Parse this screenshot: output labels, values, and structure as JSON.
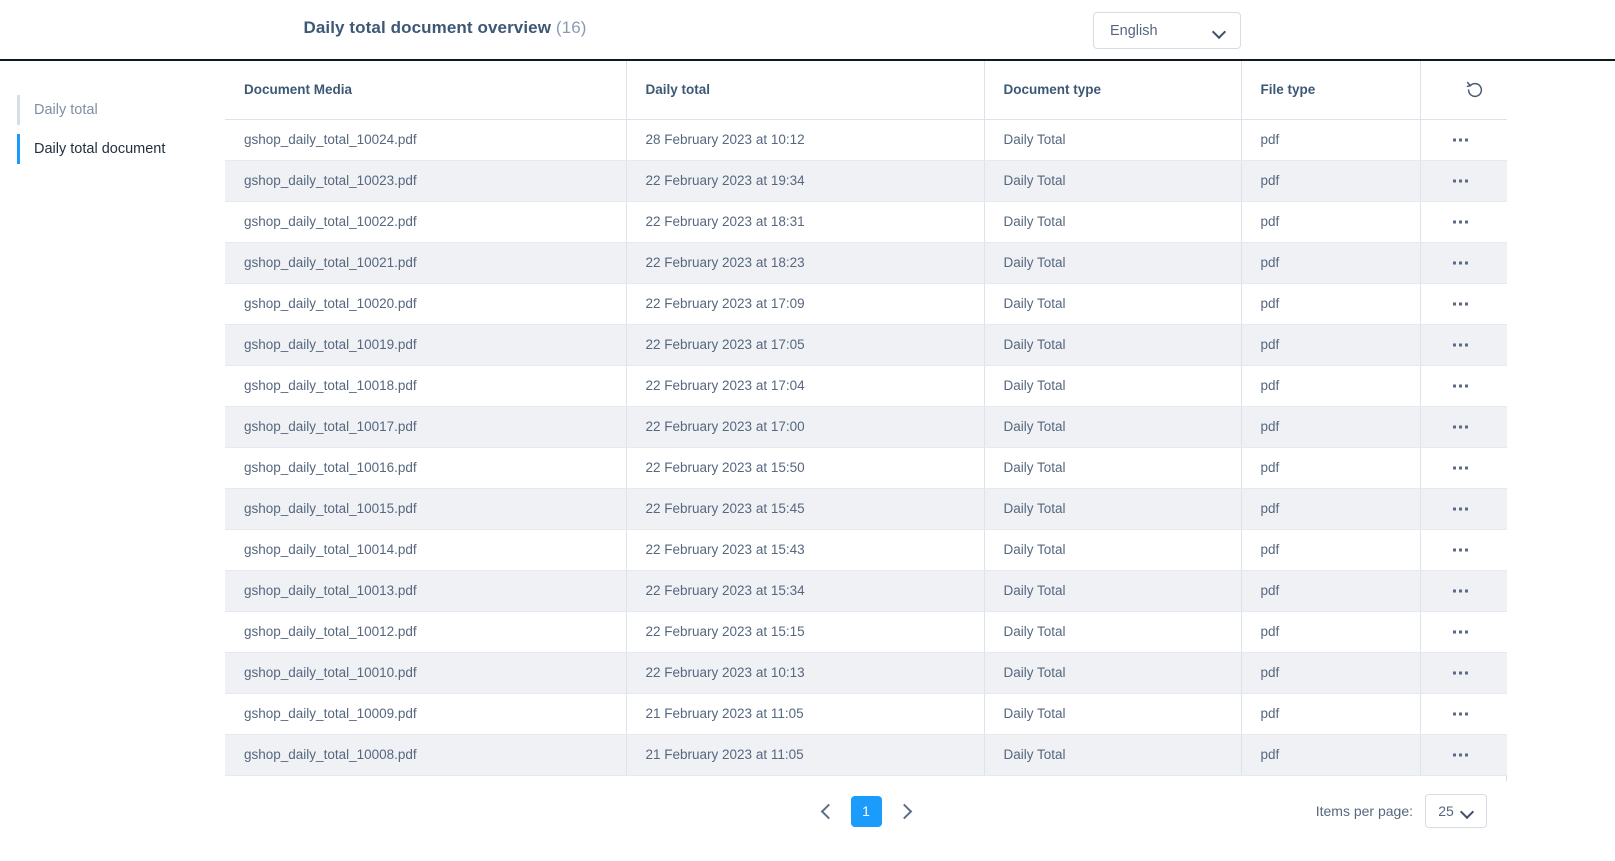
{
  "header": {
    "title": "Daily total document overview",
    "count": "(16)",
    "language_selector": {
      "value": "English",
      "icon": "chevron-down-icon"
    }
  },
  "sidebar": {
    "items": [
      {
        "label": "Daily total",
        "active": false
      },
      {
        "label": "Daily total document",
        "active": true
      }
    ]
  },
  "table": {
    "refresh_icon": "refresh-icon",
    "row_action_icon": "ellipsis-icon",
    "columns": [
      "Document Media",
      "Daily total",
      "Document type",
      "File type",
      ""
    ],
    "rows": [
      {
        "media": "gshop_daily_total_10024.pdf",
        "daily_total": "28 February 2023 at 10:12",
        "document_type": "Daily Total",
        "file_type": "pdf"
      },
      {
        "media": "gshop_daily_total_10023.pdf",
        "daily_total": "22 February 2023 at 19:34",
        "document_type": "Daily Total",
        "file_type": "pdf"
      },
      {
        "media": "gshop_daily_total_10022.pdf",
        "daily_total": "22 February 2023 at 18:31",
        "document_type": "Daily Total",
        "file_type": "pdf"
      },
      {
        "media": "gshop_daily_total_10021.pdf",
        "daily_total": "22 February 2023 at 18:23",
        "document_type": "Daily Total",
        "file_type": "pdf"
      },
      {
        "media": "gshop_daily_total_10020.pdf",
        "daily_total": "22 February 2023 at 17:09",
        "document_type": "Daily Total",
        "file_type": "pdf"
      },
      {
        "media": "gshop_daily_total_10019.pdf",
        "daily_total": "22 February 2023 at 17:05",
        "document_type": "Daily Total",
        "file_type": "pdf"
      },
      {
        "media": "gshop_daily_total_10018.pdf",
        "daily_total": "22 February 2023 at 17:04",
        "document_type": "Daily Total",
        "file_type": "pdf"
      },
      {
        "media": "gshop_daily_total_10017.pdf",
        "daily_total": "22 February 2023 at 17:00",
        "document_type": "Daily Total",
        "file_type": "pdf"
      },
      {
        "media": "gshop_daily_total_10016.pdf",
        "daily_total": "22 February 2023 at 15:50",
        "document_type": "Daily Total",
        "file_type": "pdf"
      },
      {
        "media": "gshop_daily_total_10015.pdf",
        "daily_total": "22 February 2023 at 15:45",
        "document_type": "Daily Total",
        "file_type": "pdf"
      },
      {
        "media": "gshop_daily_total_10014.pdf",
        "daily_total": "22 February 2023 at 15:43",
        "document_type": "Daily Total",
        "file_type": "pdf"
      },
      {
        "media": "gshop_daily_total_10013.pdf",
        "daily_total": "22 February 2023 at 15:34",
        "document_type": "Daily Total",
        "file_type": "pdf"
      },
      {
        "media": "gshop_daily_total_10012.pdf",
        "daily_total": "22 February 2023 at 15:15",
        "document_type": "Daily Total",
        "file_type": "pdf"
      },
      {
        "media": "gshop_daily_total_10010.pdf",
        "daily_total": "22 February 2023 at 10:13",
        "document_type": "Daily Total",
        "file_type": "pdf"
      },
      {
        "media": "gshop_daily_total_10009.pdf",
        "daily_total": "21 February 2023 at 11:05",
        "document_type": "Daily Total",
        "file_type": "pdf"
      },
      {
        "media": "gshop_daily_total_10008.pdf",
        "daily_total": "21 February 2023 at 11:05",
        "document_type": "Daily Total",
        "file_type": "pdf"
      }
    ]
  },
  "footer": {
    "prev_icon": "chevron-left-icon",
    "next_icon": "chevron-right-icon",
    "current_page": "1",
    "items_per_page_label": "Items per page:",
    "items_per_page_value": "25",
    "items_per_page_icon": "chevron-down-icon"
  },
  "colors": {
    "accent": "#1b9cfc",
    "title": "#3d5875",
    "text": "#56677e",
    "row_stripe": "#eff1f5",
    "border": "#dde3ea",
    "header_rule": "#101820"
  }
}
